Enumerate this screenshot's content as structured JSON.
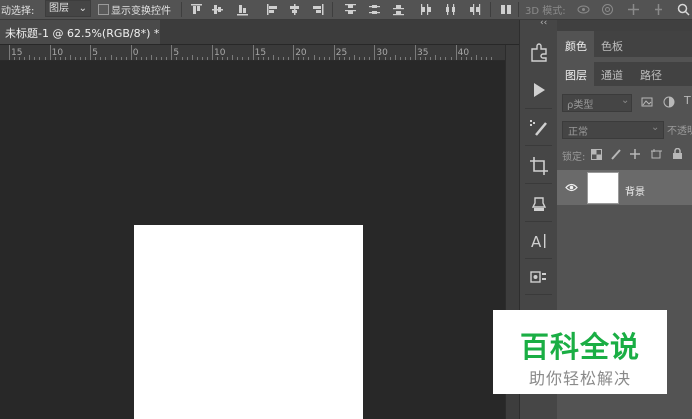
{
  "options_bar": {
    "auto_select_label": "动选择:",
    "auto_select_value": "图层",
    "show_transform_label": "显示变换控件",
    "mode_3d_label": "3D 模式:"
  },
  "document": {
    "tab_title": "未标题-1 @ 62.5%(RGB/8*) *"
  },
  "ruler": {
    "labels": [
      "15",
      "10",
      "5",
      "0",
      "5",
      "10",
      "15",
      "20",
      "25",
      "30",
      "35",
      "40"
    ]
  },
  "panel": {
    "collapse_glyph": "‹‹",
    "tabs_top": [
      "颜色",
      "色板"
    ],
    "tabs_layers": [
      "图层",
      "通道",
      "路径"
    ],
    "filter_kind": "ρ类型",
    "blend_mode": "正常",
    "opacity_label": "不透明",
    "lock_label": "锁定:",
    "layer_name": "背景"
  },
  "watermark": {
    "title": "百科全说",
    "subtitle": "助你轻松解决"
  },
  "colors": {
    "canvas_bg": "#282828",
    "document_bg": "#ffffff",
    "panel_bg": "#535353",
    "watermark_green": "#1aae44"
  }
}
